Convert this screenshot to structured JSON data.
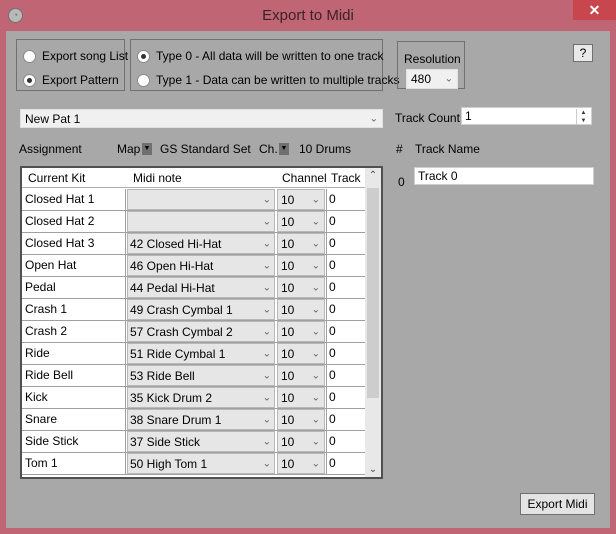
{
  "window": {
    "title": "Export to Midi",
    "close_label": "✕",
    "app_icon": "app-icon"
  },
  "export_source": {
    "options": [
      {
        "label": "Export song List",
        "checked": false
      },
      {
        "label": "Export Pattern",
        "checked": true
      }
    ]
  },
  "midi_type": {
    "options": [
      {
        "label": "Type 0 - All data will be written to one track",
        "checked": true
      },
      {
        "label": "Type 1 - Data can be written to multiple tracks",
        "checked": false
      }
    ]
  },
  "resolution": {
    "label": "Resolution",
    "value": "480"
  },
  "help_label": "?",
  "pattern_select": {
    "value": "New Pat 1"
  },
  "track_count": {
    "label": "Track Count",
    "value": "1"
  },
  "assignment": {
    "label": "Assignment",
    "map_label": "Map",
    "map_value": "GS Standard Set",
    "channel_label": "Ch.",
    "channel_value": "10 Drums"
  },
  "tracks": {
    "headers": {
      "num": "#",
      "name": "Track Name"
    },
    "rows": [
      {
        "num": "0",
        "name": "Track 0"
      }
    ]
  },
  "grid": {
    "headers": {
      "kit": "Current Kit",
      "note": "Midi note",
      "channel": "Channel",
      "track": "Track"
    },
    "rows": [
      {
        "kit": "Closed Hat 1",
        "note": "",
        "channel": "10",
        "track": "0"
      },
      {
        "kit": "Closed Hat 2",
        "note": "",
        "channel": "10",
        "track": "0"
      },
      {
        "kit": "Closed Hat 3",
        "note": "42 Closed Hi-Hat",
        "channel": "10",
        "track": "0"
      },
      {
        "kit": "Open Hat",
        "note": "46 Open Hi-Hat",
        "channel": "10",
        "track": "0"
      },
      {
        "kit": "Pedal",
        "note": "44 Pedal Hi-Hat",
        "channel": "10",
        "track": "0"
      },
      {
        "kit": "Crash 1",
        "note": "49 Crash Cymbal 1",
        "channel": "10",
        "track": "0"
      },
      {
        "kit": "Crash 2",
        "note": "57 Crash Cymbal 2",
        "channel": "10",
        "track": "0"
      },
      {
        "kit": "Ride",
        "note": "51 Ride Cymbal 1",
        "channel": "10",
        "track": "0"
      },
      {
        "kit": "Ride Bell",
        "note": "53 Ride Bell",
        "channel": "10",
        "track": "0"
      },
      {
        "kit": "Kick",
        "note": "35 Kick Drum 2",
        "channel": "10",
        "track": "0"
      },
      {
        "kit": "Snare",
        "note": "38 Snare Drum 1",
        "channel": "10",
        "track": "0"
      },
      {
        "kit": "Side Stick",
        "note": "37 Side Stick",
        "channel": "10",
        "track": "0"
      },
      {
        "kit": "Tom 1",
        "note": "50 High Tom 1",
        "channel": "10",
        "track": "0"
      }
    ]
  },
  "export_button": "Export Midi"
}
